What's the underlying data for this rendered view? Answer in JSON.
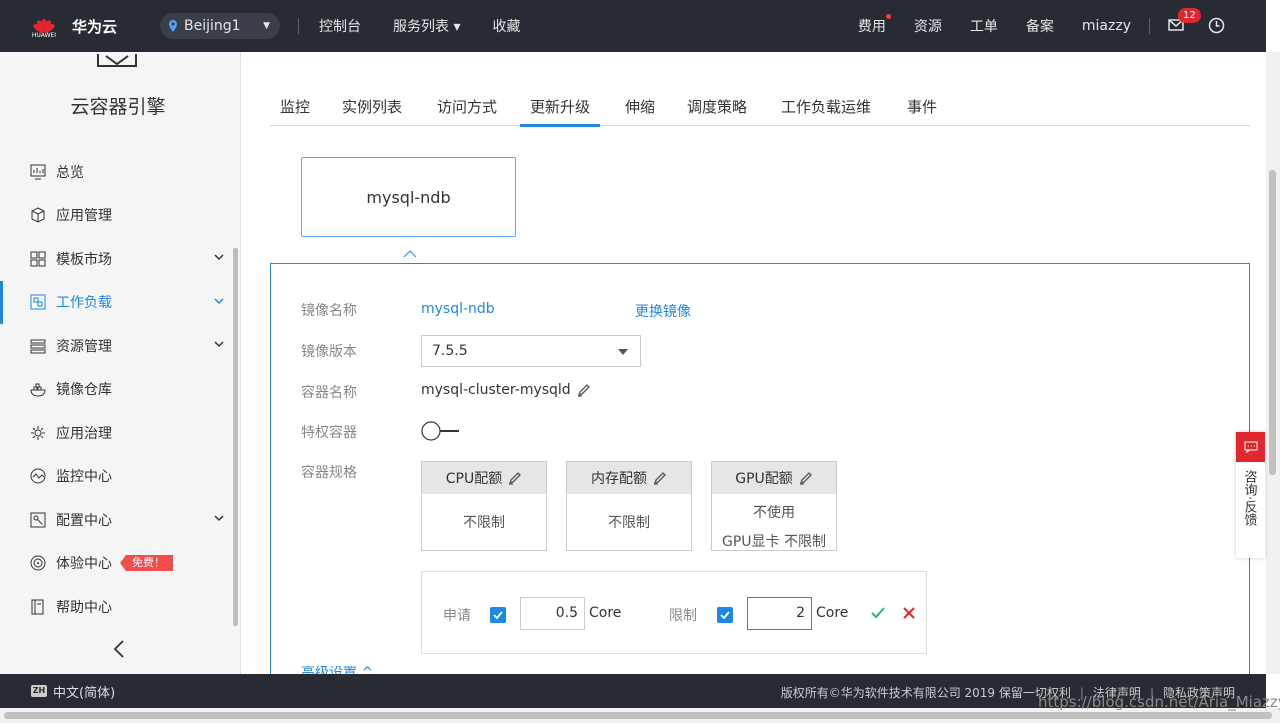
{
  "topbar": {
    "brand_sub": "HUAWEI",
    "brand_name": "华为云",
    "region": "Beijing1",
    "nav": [
      "控制台",
      "服务列表 ▾",
      "收藏"
    ],
    "right": [
      "费用",
      "资源",
      "工单",
      "备案",
      "miazzy"
    ],
    "mail_badge": "12"
  },
  "sidebar": {
    "title": "云容器引擎",
    "items": [
      {
        "label": "总览",
        "icon": "overview-icon"
      },
      {
        "label": "应用管理",
        "icon": "app-manage-icon"
      },
      {
        "label": "模板市场",
        "icon": "template-market-icon"
      },
      {
        "label": "工作负载",
        "icon": "workload-icon"
      },
      {
        "label": "资源管理",
        "icon": "resource-manage-icon"
      },
      {
        "label": "镜像仓库",
        "icon": "image-repo-icon"
      },
      {
        "label": "应用治理",
        "icon": "app-governance-icon"
      },
      {
        "label": "监控中心",
        "icon": "monitor-center-icon"
      },
      {
        "label": "配置中心",
        "icon": "config-center-icon"
      },
      {
        "label": "体验中心",
        "icon": "experience-center-icon"
      },
      {
        "label": "帮助中心",
        "icon": "help-center-icon"
      }
    ],
    "free_badge": "免费！"
  },
  "tabs": [
    "监控",
    "实例列表",
    "访问方式",
    "更新升级",
    "伸缩",
    "调度策略",
    "工作负载运维",
    "事件"
  ],
  "container_card": "mysql-ndb",
  "form": {
    "image_name_label": "镜像名称",
    "image_name": "mysql-ndb",
    "change_image": "更换镜像",
    "image_version_label": "镜像版本",
    "image_version": "7.5.5",
    "container_name_label": "容器名称",
    "container_name": "mysql-cluster-mysqld",
    "privileged_label": "特权容器",
    "spec_label": "容器规格",
    "cpu_quota": "CPU配额",
    "cpu_value": "不限制",
    "mem_quota": "内存配额",
    "mem_value": "不限制",
    "gpu_quota": "GPU配额",
    "gpu_value": "不使用",
    "gpu_card": "GPU显卡 不限制",
    "request_label": "申请",
    "request_value": "0.5",
    "limit_label": "限制",
    "limit_value": "2",
    "unit": "Core",
    "advanced": "高级设置 ^"
  },
  "consult": "咨询·反馈",
  "footer": {
    "lang_icon": "ZH",
    "lang": "中文(简体)",
    "copyright": "版权所有©华为软件技术有限公司 2019 保留一切权利",
    "legal": "法律声明",
    "privacy": "隐私政策声明"
  },
  "watermark": "https://blog.csdn.net/Aria_Miazzy"
}
